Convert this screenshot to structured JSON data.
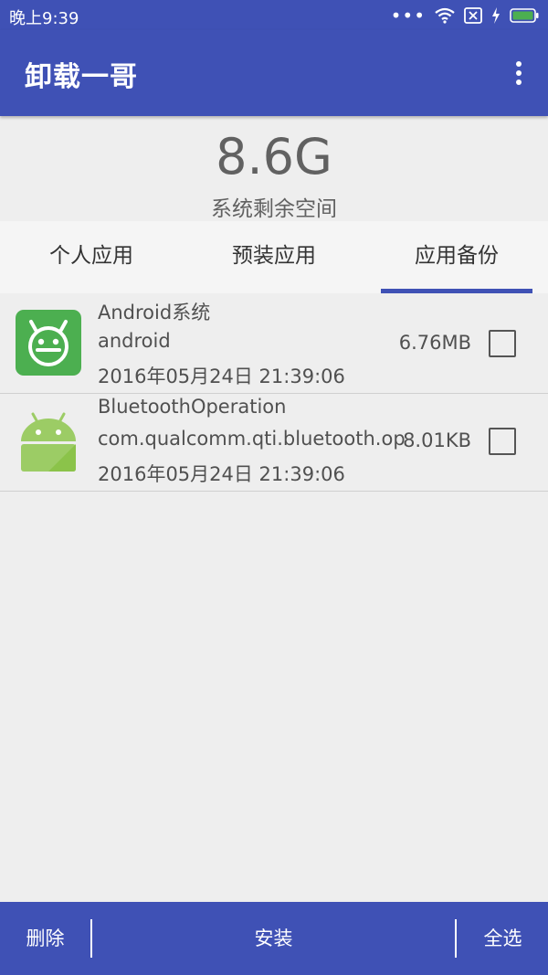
{
  "status_bar": {
    "time": "晚上9:39",
    "icons": [
      "more-dots-icon",
      "wifi-icon",
      "sim-off-icon",
      "charging-icon",
      "battery-icon"
    ],
    "battery_color": "#4caf50"
  },
  "app_bar": {
    "title": "卸载一哥",
    "overflow_icon": "more-vert-icon"
  },
  "storage": {
    "value": "8.6G",
    "label": "系统剩余空间"
  },
  "tabs": [
    {
      "label": "个人应用",
      "selected": false
    },
    {
      "label": "预装应用",
      "selected": false
    },
    {
      "label": "应用备份",
      "selected": true
    }
  ],
  "apps": [
    {
      "name": "Android系统",
      "package": "android",
      "date": "2016年05月24日 21:39:06",
      "size": "6.76MB",
      "checked": false,
      "icon": "android-face-icon"
    },
    {
      "name": "BluetoothOperation",
      "package": "com.qualcomm.qti.bluetooth.op",
      "date": "2016年05月24日 21:39:06",
      "size": "8.01KB",
      "checked": false,
      "icon": "android-robot-icon"
    }
  ],
  "bottom_bar": {
    "delete": "删除",
    "install": "安装",
    "select_all": "全选"
  },
  "colors": {
    "primary": "#3f51b5",
    "background": "#eeeeee",
    "android_green": "#4caf50",
    "robot_green": "#9ccc65"
  }
}
